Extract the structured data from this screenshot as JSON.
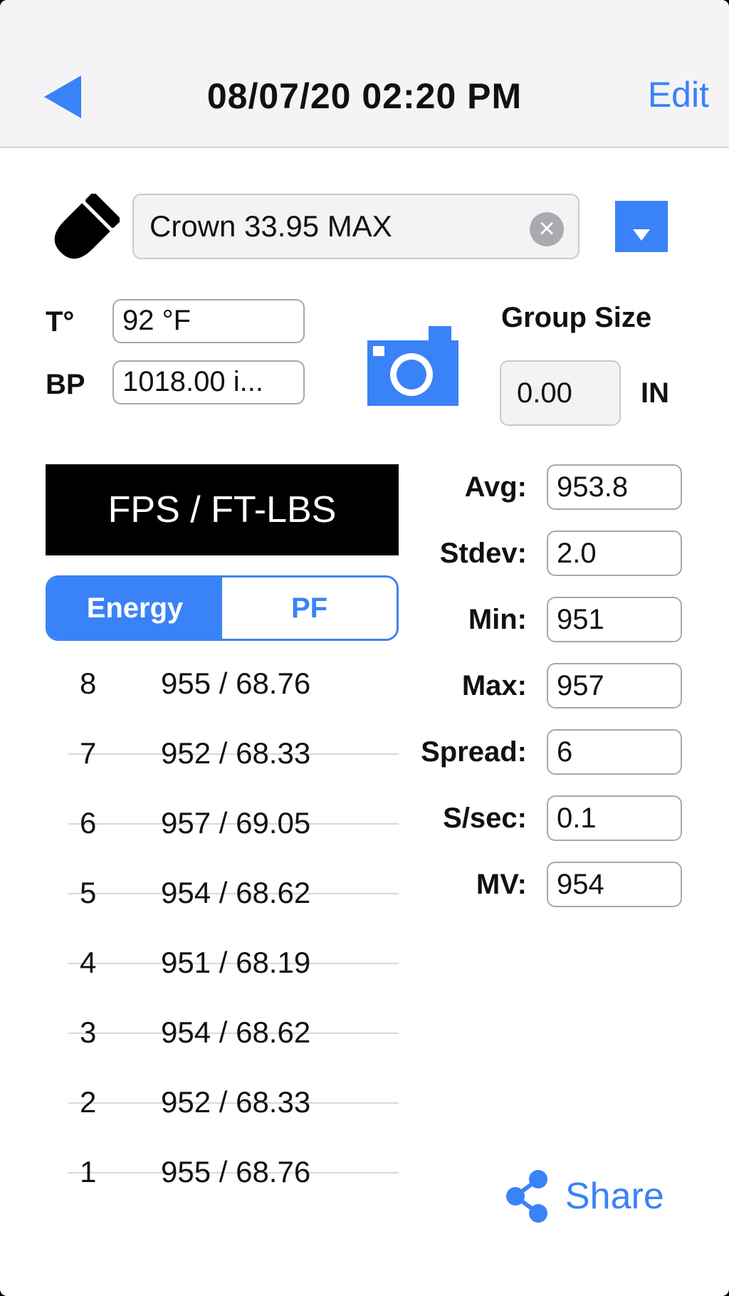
{
  "header": {
    "back_icon": "back-triangle-icon",
    "title": "08/07/20 02:20 PM",
    "edit_label": "Edit",
    "accent_color": "#3a82f7"
  },
  "load": {
    "name": "Crown 33.95 MAX",
    "clear_icon": "clear-icon",
    "dropdown_icon": "dropdown-icon"
  },
  "environment": {
    "temp_label": "T°",
    "temp_value": "92 °F",
    "pressure_label": "BP",
    "pressure_value": "1018.00 i..."
  },
  "group": {
    "label": "Group Size",
    "value": "0.00",
    "unit": "IN"
  },
  "units_header": "FPS / FT-LBS",
  "mode": {
    "energy_label": "Energy",
    "pf_label": "PF",
    "selected": "Energy"
  },
  "shots": [
    {
      "num": "8",
      "value": "955 / 68.76"
    },
    {
      "num": "7",
      "value": "952 / 68.33"
    },
    {
      "num": "6",
      "value": "957 / 69.05"
    },
    {
      "num": "5",
      "value": "954 / 68.62"
    },
    {
      "num": "4",
      "value": "951 / 68.19"
    },
    {
      "num": "3",
      "value": "954 / 68.62"
    },
    {
      "num": "2",
      "value": "952 / 68.33"
    },
    {
      "num": "1",
      "value": "955 / 68.76"
    }
  ],
  "stats": [
    {
      "label": "Avg:",
      "value": "953.8"
    },
    {
      "label": "Stdev:",
      "value": "2.0"
    },
    {
      "label": "Min:",
      "value": "951"
    },
    {
      "label": "Max:",
      "value": "957"
    },
    {
      "label": "Spread:",
      "value": "6"
    },
    {
      "label": "S/sec:",
      "value": "0.1"
    },
    {
      "label": "MV:",
      "value": "954"
    }
  ],
  "share_label": "Share"
}
